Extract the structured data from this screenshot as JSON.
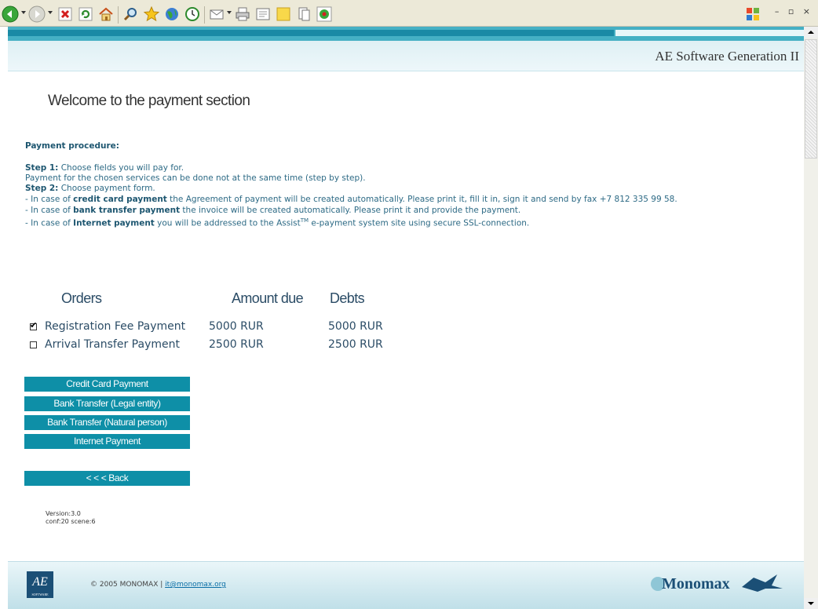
{
  "browser": {
    "window_controls": "– ▫ ×"
  },
  "page": {
    "brand_title": "AE Software Generation II",
    "heading": "Welcome to the payment section",
    "procedure": {
      "title": "Payment procedure:",
      "step1_label": "Step 1:",
      "step1_text": " Choose fields you will pay for.",
      "step1_note": "Payment for the chosen services can be done not at the same time (step by step).",
      "step2_label": "Step 2:",
      "step2_text": " Choose payment form.",
      "credit_prefix": "- In case of ",
      "credit_bold": "credit card payment",
      "credit_text": " the Agreement of payment will be created automatically. Please print it, fill it in, sign it and send by fax +7 812 335 99 58.",
      "bank_prefix": "- In case of ",
      "bank_bold": "bank transfer payment",
      "bank_text": " the invoice will be created automatically. Please print it and provide the payment.",
      "internet_prefix": "- In case of ",
      "internet_bold": "Internet payment",
      "internet_text_before": " you will be addressed to the Assist",
      "internet_tm": "TM",
      "internet_text_after": " e-payment system site using secure SSL-connection."
    },
    "orders": {
      "columns": [
        "Orders",
        "Amount due",
        "Debts"
      ],
      "rows": [
        {
          "name": "Registration Fee Payment",
          "amount": "5000 RUR",
          "debt": "5000 RUR",
          "checked": true
        },
        {
          "name": "Arrival Transfer Payment",
          "amount": "2500 RUR",
          "debt": "2500 RUR",
          "checked": false
        }
      ]
    },
    "buttons": {
      "credit_card": "Credit Card Payment",
      "bank_legal": "Bank Transfer (Legal entity)",
      "bank_natural": "Bank Transfer (Natural person)",
      "internet": "Internet Payment",
      "back": "< < < Back"
    },
    "version": {
      "line1": "Version:3.0",
      "line2": "conf:20 scene:6"
    },
    "footer": {
      "logo_text": "AE",
      "logo_sub": "SOFTWARE",
      "copyright": "© 2005 MONOMAX | ",
      "email": "it@monomax.org",
      "partner_logo": "Monomax"
    }
  },
  "colors": {
    "accent": "#0e8fa7",
    "text": "#2b4c66",
    "band": "#45b0c4"
  }
}
